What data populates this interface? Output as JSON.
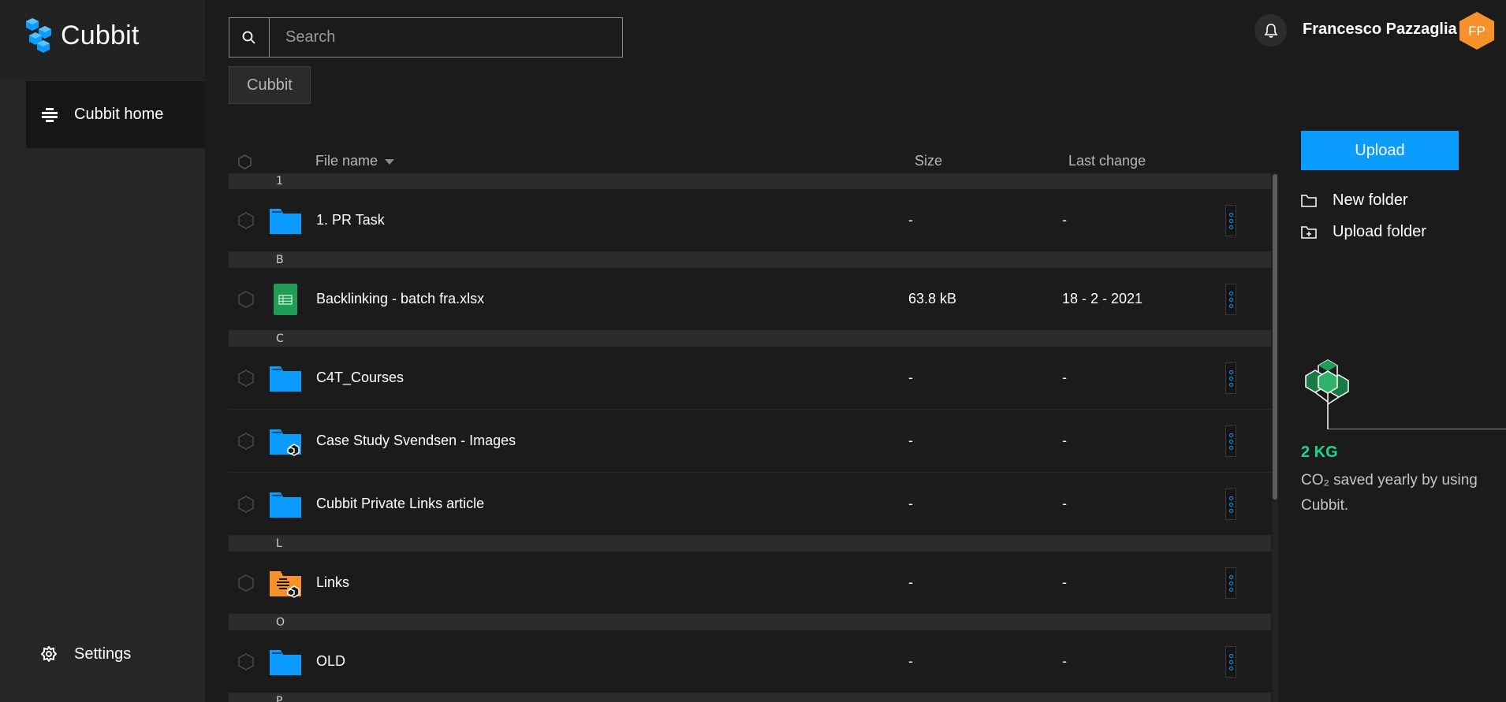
{
  "app": {
    "logo_text": "Cubbit",
    "brand_color": "#0a9cff"
  },
  "sidebar": {
    "items": [
      {
        "label": "Cubbit home",
        "icon": "cubbit-home-icon",
        "active": true
      },
      {
        "label": "Settings",
        "icon": "gear-icon",
        "active": false
      }
    ]
  },
  "search": {
    "placeholder": "Search",
    "value": ""
  },
  "breadcrumb": {
    "label": "Cubbit"
  },
  "header": {
    "user_name": "Francesco Pazzaglia",
    "avatar_initials": "FP",
    "avatar_color": "#f7922b"
  },
  "table": {
    "columns": {
      "name": "File name",
      "size": "Size",
      "change": "Last change"
    },
    "groups": [
      {
        "letter": "1",
        "rows": [
          {
            "name": "1. PR Task",
            "size": "-",
            "change": "-",
            "icon": "folder-icon"
          }
        ]
      },
      {
        "letter": "B",
        "rows": [
          {
            "name": "Backlinking - batch fra.xlsx",
            "size": "63.8 kB",
            "change": "18 - 2 - 2021",
            "icon": "spreadsheet-icon"
          }
        ]
      },
      {
        "letter": "C",
        "rows": [
          {
            "name": "C4T_Courses",
            "size": "-",
            "change": "-",
            "icon": "folder-icon"
          },
          {
            "name": "Case Study Svendsen - Images",
            "size": "-",
            "change": "-",
            "icon": "shared-folder-icon"
          },
          {
            "name": "Cubbit Private Links article",
            "size": "-",
            "change": "-",
            "icon": "folder-icon"
          }
        ]
      },
      {
        "letter": "L",
        "rows": [
          {
            "name": "Links",
            "size": "-",
            "change": "-",
            "icon": "orange-shared-folder-icon"
          }
        ]
      },
      {
        "letter": "O",
        "rows": [
          {
            "name": "OLD",
            "size": "-",
            "change": "-",
            "icon": "folder-icon"
          }
        ]
      },
      {
        "letter": "P",
        "rows": []
      }
    ]
  },
  "actions": {
    "upload": "Upload",
    "new_folder": "New folder",
    "upload_folder": "Upload folder"
  },
  "co2": {
    "amount": "2 KG",
    "text": "CO₂ saved yearly by using Cubbit.",
    "color": "#1fd48b"
  }
}
